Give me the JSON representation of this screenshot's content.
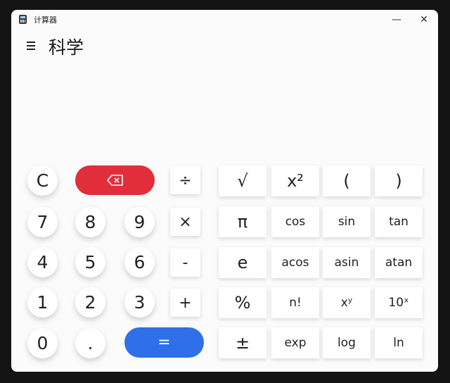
{
  "window": {
    "title": "计算器",
    "minimize_label": "—",
    "close_label": "✕"
  },
  "header": {
    "menu_icon": "hamburger-menu-icon",
    "mode_title": "科学"
  },
  "display": {
    "expression": "",
    "result": ""
  },
  "keypad": {
    "clear": "C",
    "backspace_icon": "backspace-icon",
    "equals": "=",
    "digits": {
      "zero": "0",
      "one": "1",
      "two": "2",
      "three": "3",
      "four": "4",
      "five": "5",
      "six": "6",
      "seven": "7",
      "eight": "8",
      "nine": "9"
    },
    "decimal": ".",
    "divide": "÷",
    "multiply": "×",
    "subtract": "-",
    "add": "+"
  },
  "scientific": {
    "sqrt": "√",
    "square": "x²",
    "open_paren": "(",
    "close_paren": ")",
    "pi": "π",
    "cos": "cos",
    "sin": "sin",
    "tan": "tan",
    "e": "e",
    "acos": "acos",
    "asin": "asin",
    "atan": "atan",
    "percent": "%",
    "factorial": "n!",
    "power": "xʸ",
    "ten_power": "10ˣ",
    "plus_minus": "±",
    "exp": "exp",
    "log": "log",
    "ln": "ln"
  },
  "colors": {
    "backspace": "#e12e3a",
    "equals": "#2f6fe8",
    "window_bg": "#fbfbfb"
  }
}
